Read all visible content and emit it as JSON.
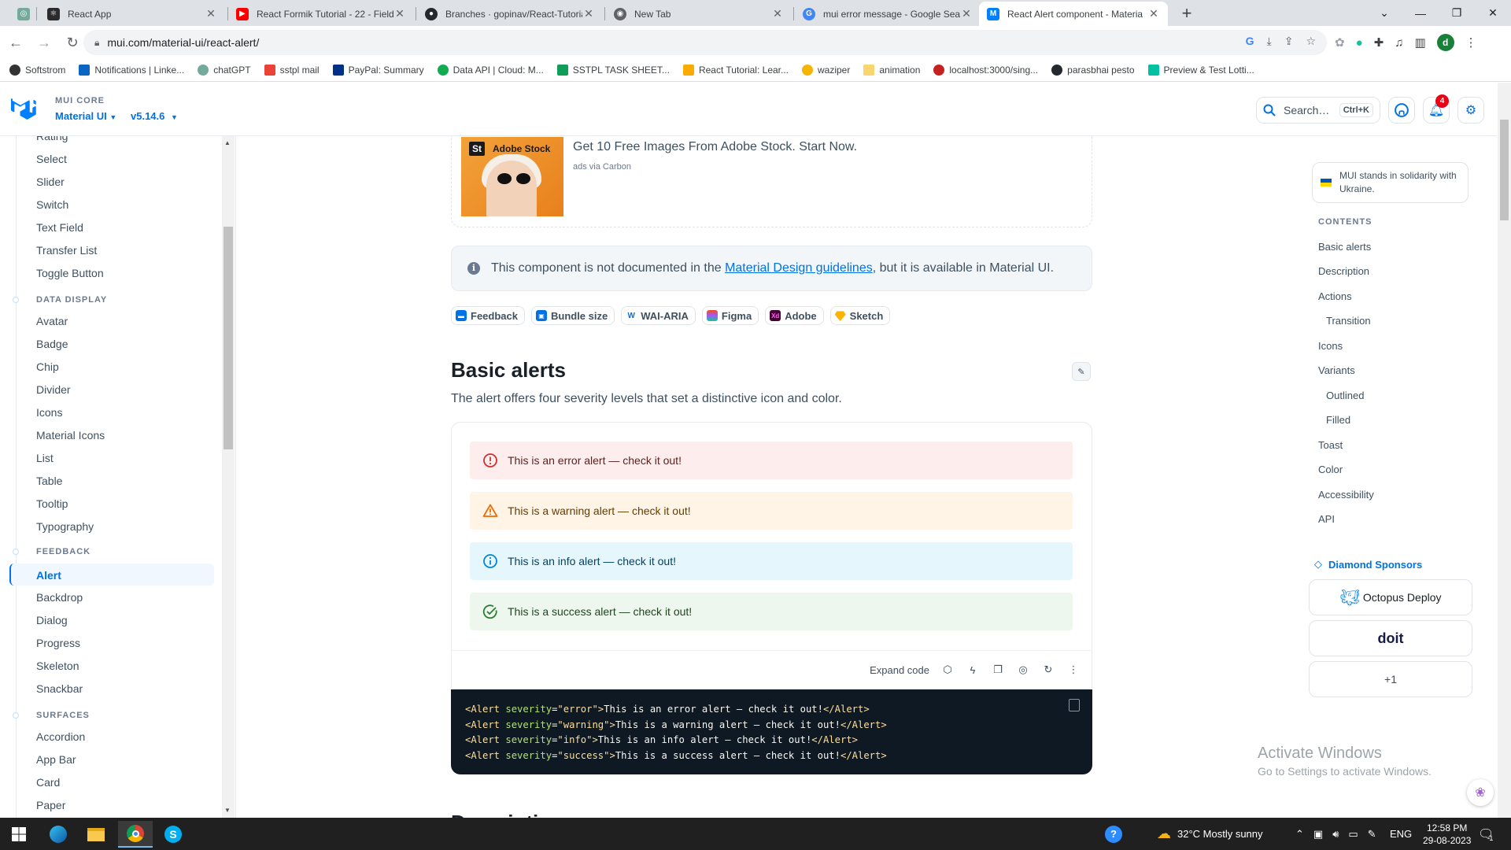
{
  "browser": {
    "tabs": [
      {
        "title": "",
        "icon": "react-app-favicon"
      },
      {
        "title": "React App",
        "icon": "react-favicon"
      },
      {
        "title": "React Formik Tutorial - 22 - Field",
        "icon": "youtube-favicon"
      },
      {
        "title": "Branches · gopinav/React-Tutoria",
        "icon": "github-favicon"
      },
      {
        "title": "New Tab",
        "icon": "chrome-favicon"
      },
      {
        "title": "mui error message - Google Sear",
        "icon": "google-favicon"
      },
      {
        "title": "React Alert component - Materia",
        "icon": "mui-favicon"
      }
    ],
    "url": "mui.com/material-ui/react-alert/",
    "bookmarks": [
      {
        "label": "Softstrom",
        "color": "#333"
      },
      {
        "label": "Notifications | Linke...",
        "color": "#0a66c2"
      },
      {
        "label": "chatGPT",
        "color": "#74aa9c"
      },
      {
        "label": "sstpl mail",
        "color": "#ea4335"
      },
      {
        "label": "PayPal: Summary",
        "color": "#003087"
      },
      {
        "label": "Data API | Cloud: M...",
        "color": "#13aa52"
      },
      {
        "label": "SSTPL TASK SHEET...",
        "color": "#0f9d58"
      },
      {
        "label": "React Tutorial: Lear...",
        "color": "#f9ab00"
      },
      {
        "label": "waziper",
        "color": "#f4b400"
      },
      {
        "label": "animation",
        "color": "#f9d56e"
      },
      {
        "label": "localhost:3000/sing...",
        "color": "#c5221f"
      },
      {
        "label": "parasbhai pesto",
        "color": "#24292f"
      },
      {
        "label": "Preview & Test Lotti...",
        "color": "#00c1a2"
      }
    ]
  },
  "header": {
    "core_label": "MUI CORE",
    "product": "Material UI",
    "version": "v5.14.6",
    "search_placeholder": "Search…",
    "search_shortcut": "Ctrl+K",
    "notification_count": "4"
  },
  "sidebar": {
    "partial_item": "Rating",
    "items_top": [
      "Select",
      "Slider",
      "Switch",
      "Text Field",
      "Transfer List",
      "Toggle Button"
    ],
    "section_display": "DATA DISPLAY",
    "items_display": [
      "Avatar",
      "Badge",
      "Chip",
      "Divider",
      "Icons",
      "Material Icons",
      "List",
      "Table",
      "Tooltip",
      "Typography"
    ],
    "section_feedback": "FEEDBACK",
    "items_feedback": [
      "Alert",
      "Backdrop",
      "Dialog",
      "Progress",
      "Skeleton",
      "Snackbar"
    ],
    "section_surfaces": "SURFACES",
    "items_surfaces": [
      "Accordion",
      "App Bar",
      "Card",
      "Paper"
    ]
  },
  "ad": {
    "brand": "Adobe Stock",
    "brand_short": "St",
    "title": "Get 10 Free Images From Adobe Stock. Start Now.",
    "sub": "ads via Carbon"
  },
  "callout": {
    "before": "This component is not documented in the ",
    "link": "Material Design guidelines",
    "after": ", but it is available in Material UI."
  },
  "chips": [
    "Feedback",
    "Bundle size",
    "WAI-ARIA",
    "Figma",
    "Adobe",
    "Sketch"
  ],
  "basic_alerts": {
    "heading": "Basic alerts",
    "description": "The alert offers four severity levels that set a distinctive icon and color.",
    "alerts": {
      "error": "This is an error alert — check it out!",
      "warning": "This is a warning alert — check it out!",
      "info": "This is an info alert — check it out!",
      "success": "This is a success alert — check it out!"
    },
    "expand_code": "Expand code",
    "code_lines": [
      {
        "sev": "error",
        "text": "This is an error alert — check it out!"
      },
      {
        "sev": "warning",
        "text": "This is a warning alert — check it out!"
      },
      {
        "sev": "info",
        "text": "This is an info alert — check it out!"
      },
      {
        "sev": "success",
        "text": "This is a success alert — check it out!"
      }
    ]
  },
  "next_heading": "Description",
  "toc": {
    "ukraine": "MUI stands in solidarity with Ukraine.",
    "heading": "CONTENTS",
    "items": [
      "Basic alerts",
      "Description",
      "Actions",
      "Transition",
      "Icons",
      "Variants",
      "Outlined",
      "Filled",
      "Toast",
      "Color",
      "Accessibility",
      "API"
    ],
    "sponsors_heading": "Diamond Sponsors",
    "sponsors": [
      "Octopus Deploy",
      "doit",
      "+1"
    ]
  },
  "watermark": {
    "line1": "Activate Windows",
    "line2": "Go to Settings to activate Windows."
  },
  "taskbar": {
    "weather": "32°C  Mostly sunny",
    "lang": "ENG",
    "time": "12:58 PM",
    "date": "29-08-2023",
    "notif_count": "1"
  },
  "colors": {
    "brand_blue": "#0072e5",
    "error_bg": "#fdeded",
    "warning_bg": "#fff4e5",
    "info_bg": "#e5f6fd",
    "success_bg": "#edf7ed"
  }
}
